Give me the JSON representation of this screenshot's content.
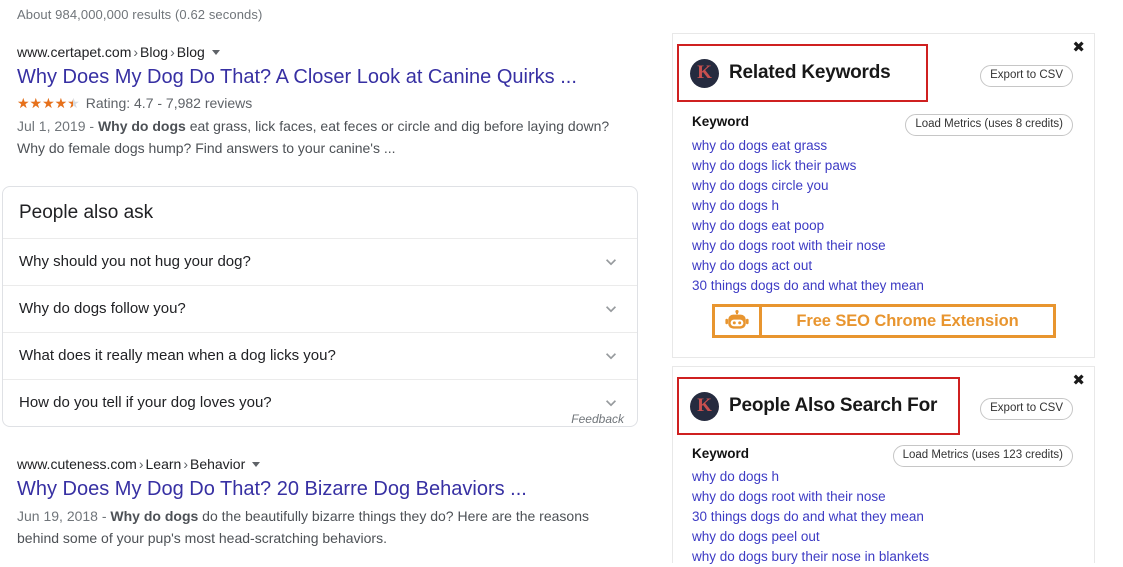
{
  "serp": {
    "result_stats": "About 984,000,000 results (0.62 seconds)",
    "results": [
      {
        "breadcrumb_domain": "www.certapet.com",
        "breadcrumb_parts": [
          "Blog",
          "Blog"
        ],
        "title": "Why Does My Dog Do That? A Closer Look at Canine Quirks ...",
        "rating_label": "Rating: 4.7 - 7,982 reviews",
        "rating_value": 4.5,
        "date": "Jul 1, 2019 - ",
        "snippet_bold": "Why do dogs",
        "snippet_rest": " eat grass, lick faces, eat feces or circle and dig before laying down? Why do female dogs hump? Find answers to your canine's ..."
      },
      {
        "breadcrumb_domain": "www.cuteness.com",
        "breadcrumb_parts": [
          "Learn",
          "Behavior"
        ],
        "title": "Why Does My Dog Do That? 20 Bizarre Dog Behaviors ...",
        "date": "Jun 19, 2018 - ",
        "snippet_bold": "Why do dogs",
        "snippet_rest": " do the beautifully bizarre things they do? Here are the reasons behind some of your pup's most head-scratching behaviors."
      }
    ],
    "people_also_ask": {
      "heading": "People also ask",
      "questions": [
        "Why should you not hug your dog?",
        "Why do dogs follow you?",
        "What does it really mean when a dog licks you?",
        "How do you tell if your dog loves you?"
      ],
      "feedback_label": "Feedback"
    }
  },
  "keyword_panels": [
    {
      "brand_initial": "K",
      "title": "Related Keywords",
      "close_label": "✖",
      "export_label": "Export to CSV",
      "metrics_label": "Load Metrics (uses 8 credits)",
      "column_header": "Keyword",
      "keywords": [
        "why do dogs eat grass",
        "why do dogs lick their paws",
        "why do dogs circle you",
        "why do dogs h",
        "why do dogs eat poop",
        "why do dogs root with their nose",
        "why do dogs act out",
        "30 things dogs do and what they mean"
      ],
      "extension_cta": "Free SEO Chrome Extension"
    },
    {
      "brand_initial": "K",
      "title": "People Also Search For",
      "close_label": "✖",
      "export_label": "Export to CSV",
      "metrics_label": "Load Metrics (uses 123 credits)",
      "column_header": "Keyword",
      "keywords": [
        "why do dogs h",
        "why do dogs root with their nose",
        "30 things dogs do and what they mean",
        "why do dogs peel out",
        "why do dogs bury their nose in blankets"
      ]
    }
  ],
  "colors": {
    "link": "#3730a3",
    "keyword_link": "#3d3bc4",
    "highlight_border": "#cf2020",
    "extension_orange": "#e8952f",
    "star": "#e7711b",
    "brand_circle": "#252b3f"
  }
}
